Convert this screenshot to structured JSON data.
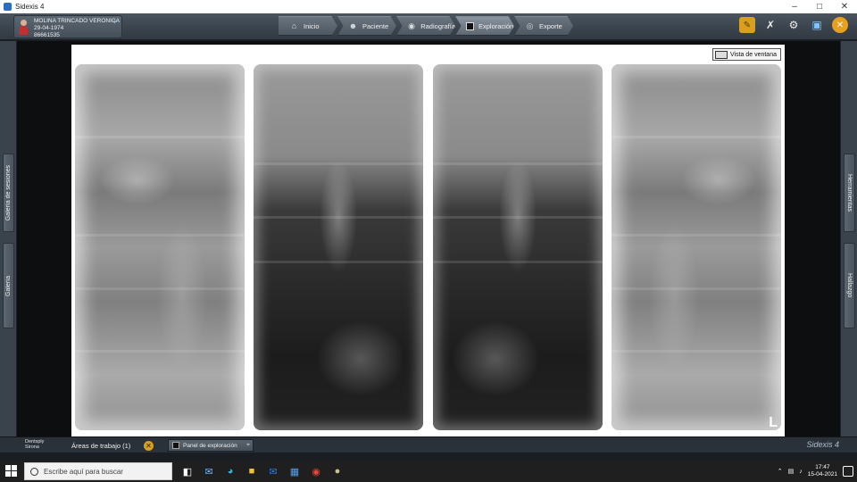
{
  "window": {
    "title": "Sidexis 4"
  },
  "patient": {
    "name": "MOLINA TRINCADO VERONICA",
    "birthdate": "29-04-1974",
    "id": "86661535"
  },
  "nav": {
    "tabs": [
      {
        "label": "Inicio",
        "icon": "home-icon"
      },
      {
        "label": "Paciente",
        "icon": "patient-icon"
      },
      {
        "label": "Radiografía",
        "icon": "xray-source-icon"
      },
      {
        "label": "Exploración",
        "icon": "exploration-icon",
        "active": true
      },
      {
        "label": "Exporte",
        "icon": "globe-icon"
      }
    ]
  },
  "tools": [
    "notes-icon",
    "tools-icon",
    "settings-gear-icon",
    "monitor-icon",
    "close-circle-icon"
  ],
  "left_rail": {
    "tab1": "Galería de sesiones",
    "tab2": "Galería"
  },
  "right_rail": {
    "tab1": "Herramientas",
    "tab2": "Hallazgo"
  },
  "viewer": {
    "window_view_label": "Vista de ventana",
    "side_marker": "L"
  },
  "bottom": {
    "brand_line1": "Dentsply",
    "brand_line2": "Sirona",
    "work_areas": "Áreas de trabajo (1)",
    "panel_label": "Panel de exploración",
    "app_name": "Sidexis 4"
  },
  "taskbar": {
    "search_placeholder": "Escribe aquí para buscar",
    "time": "17:47",
    "date": "15-04-2021"
  },
  "colors": {
    "accent": "#d9a020",
    "topbar": "#3a434c",
    "canvas": "#ffffff"
  }
}
